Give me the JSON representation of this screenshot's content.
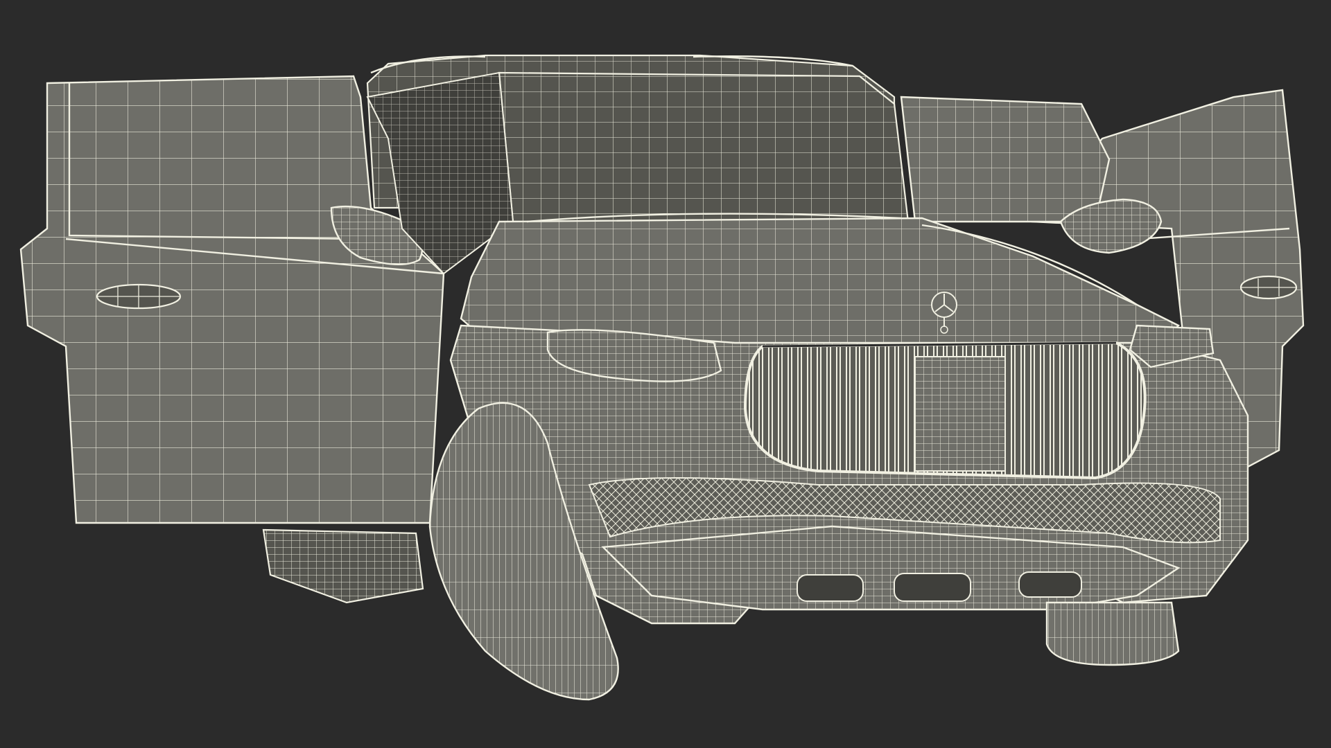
{
  "scene": {
    "subject": "",
    "colors": {
      "background": "#2b2b2b",
      "surface": "#6e6e68",
      "wireframe": "#ecebdc"
    }
  }
}
